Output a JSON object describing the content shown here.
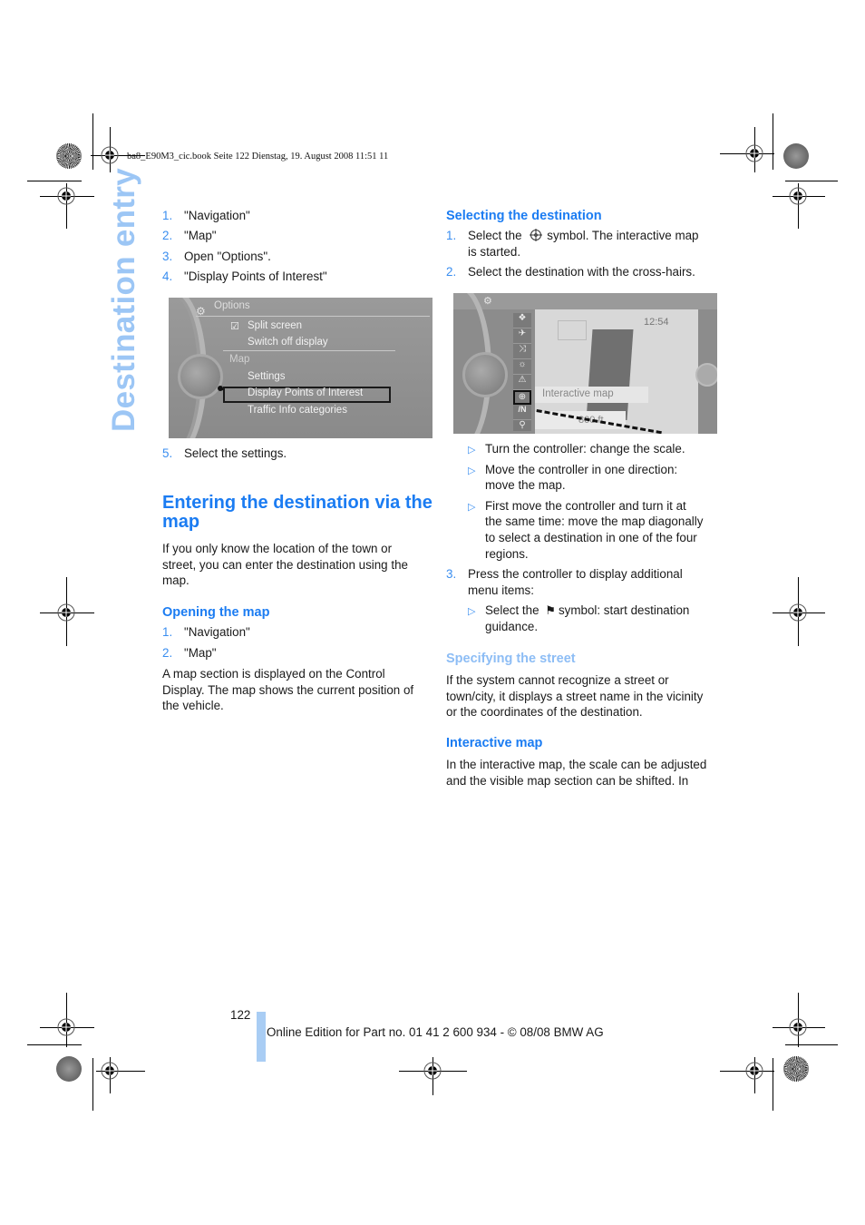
{
  "print_meta": "ba8_E90M3_cic.book  Seite 122  Dienstag, 19. August 2008  11:51 11",
  "side_title": "Destination entry",
  "left_column": {
    "steps_a": [
      {
        "num": "1.",
        "text": "\"Navigation\""
      },
      {
        "num": "2.",
        "text": "\"Map\""
      },
      {
        "num": "3.",
        "text": "Open \"Options\"."
      },
      {
        "num": "4.",
        "text": "\"Display Points of Interest\""
      }
    ],
    "options_screen": {
      "title": "Options",
      "items": [
        "Split screen",
        "Switch off display"
      ],
      "section": "Map",
      "map_items": [
        "Settings",
        "Display Points of Interest",
        "Traffic Info categories"
      ],
      "selected": "Display Points of Interest"
    },
    "step_5": {
      "num": "5.",
      "text": "Select the settings."
    },
    "section_heading": "Entering the destination via the map",
    "intro": "If you only know the location of the town or street, you can enter the destination using the map.",
    "opening_heading": "Opening the map",
    "steps_b": [
      {
        "num": "1.",
        "text": "\"Navigation\""
      },
      {
        "num": "2.",
        "text": "\"Map\""
      }
    ],
    "opening_text": "A map section is displayed on the Control Display. The map shows the current position of the vehicle."
  },
  "right_column": {
    "selecting_heading": "Selecting the destination",
    "step_1_a": "Select the",
    "step_1_b": "symbol. The interactive map",
    "step_1_c": "is started.",
    "step_2": "Select the destination with the cross-hairs.",
    "map_screen": {
      "time": "12:54",
      "label": "Interactive map",
      "scale": "800 ft."
    },
    "bullets": [
      [
        "Turn the controller: change the scale."
      ],
      [
        "Move the controller in one direction:",
        "move the map."
      ],
      [
        "First move the controller and turn it at",
        "the same time: move the map diagonally",
        "to select a destination in one of the four",
        "regions."
      ]
    ],
    "step_3": [
      "Press the controller to display additional",
      "menu items:"
    ],
    "sub_bullet_a": "Select the",
    "sub_bullet_b": "symbol: start destination",
    "sub_bullet_c": "guidance.",
    "street_heading": "Specifying the street",
    "street_text": "If the system cannot recognize a street or town/city, it displays a street name in the vicinity or the coordinates of the destination.",
    "interactive_heading": "Interactive map",
    "interactive_text": "In the interactive map, the scale can be adjusted and the visible map section can be shifted. In"
  },
  "footer": {
    "page_number": "122",
    "edition": "Online Edition for Part no. 01 41 2 600 934 - © 08/08 BMW AG"
  },
  "colors": {
    "heading_blue": "#1b7cf2",
    "number_blue": "#3a8ef0",
    "side_title_blue": "#9cc6f5",
    "footer_bar": "#a9cdf4"
  }
}
